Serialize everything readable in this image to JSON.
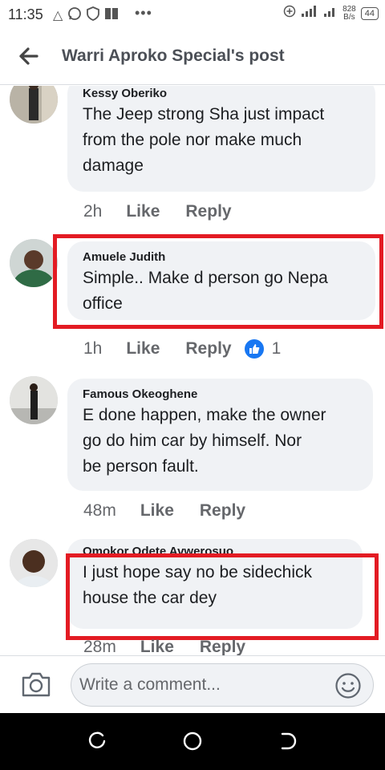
{
  "status_bar": {
    "time": "11:35",
    "speed_value": "828",
    "speed_unit": "B/s",
    "battery": "44"
  },
  "header": {
    "title": "Warri Aproko Special's post"
  },
  "comments": [
    {
      "author": "Kessy Oberiko",
      "text_lines": [
        "The Jeep strong Sha just impact",
        "from the pole nor make much",
        "damage"
      ],
      "time": "2h",
      "like_label": "Like",
      "reply_label": "Reply"
    },
    {
      "author": "Amuele Judith",
      "text_lines": [
        "Simple.. Make d person go Nepa",
        "office"
      ],
      "time": "1h",
      "like_label": "Like",
      "reply_label": "Reply",
      "reaction_count": "1",
      "highlighted": true
    },
    {
      "author": "Famous Okeoghene",
      "text_lines": [
        "E done happen, make the owner",
        "go do him car by himself. Nor",
        "be person fault."
      ],
      "time": "48m",
      "like_label": "Like",
      "reply_label": "Reply"
    },
    {
      "author": "Omokor Odete Avwerosuo",
      "text_lines": [
        "I just hope say no be sidechick",
        "house the car dey"
      ],
      "time": "28m",
      "like_label": "Like",
      "reply_label": "Reply",
      "highlighted": true
    }
  ],
  "comment_bar": {
    "placeholder": "Write a comment..."
  },
  "colors": {
    "highlight": "#e31b23",
    "bubble": "#f0f2f5",
    "like_blue": "#1877f2"
  }
}
